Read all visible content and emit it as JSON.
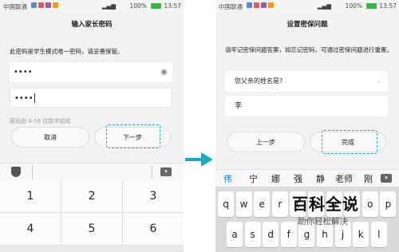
{
  "status_bar": {
    "carrier": "中国联通",
    "battery_pct": "100%",
    "time": "13:57",
    "signal_text": "4G",
    "app_icon_colors": [
      "#4a90e2",
      "#e55b5b",
      "#9b59b6",
      "#f39c12"
    ],
    "battery_color": "#3bb44a"
  },
  "left": {
    "title": "输入家长密码",
    "instruction": "此密码是学生模式唯一密码，请妥善保管。",
    "password1": "••••",
    "password2": "••••",
    "hint": "密码由 4-16 位数字组成",
    "cancel_label": "取消",
    "next_label": "下一步",
    "keypad_icons": [
      "shield-icon",
      "keyboard-collapse-icon"
    ],
    "keypad": [
      "1",
      "2",
      "3",
      "4",
      "5",
      "6"
    ]
  },
  "right": {
    "title": "设置密保问题",
    "instruction": "请牢记密保问题答案，如忘记密码，可通过密保问题进行重置。",
    "question": "您父亲的姓名是?",
    "answer": "李",
    "prev_label": "上一步",
    "done_label": "完成",
    "candidates": [
      "伟",
      "宁",
      "娜",
      "强",
      "静",
      "老师",
      "刚"
    ],
    "keyboard_row1": [
      "q",
      "w",
      "e",
      "r",
      "t",
      "y",
      "u",
      "i",
      "o",
      "p"
    ],
    "keyboard_row2": [
      "a",
      "s",
      "d",
      "f",
      "g",
      "h",
      "j",
      "k",
      "l"
    ]
  },
  "watermark": {
    "title": "百科全说",
    "subtitle": "助你轻松解决"
  },
  "colors": {
    "highlight": "#1fa8c1",
    "arrow": "#1fa8c1",
    "candidate_active": "#1a73e8"
  }
}
